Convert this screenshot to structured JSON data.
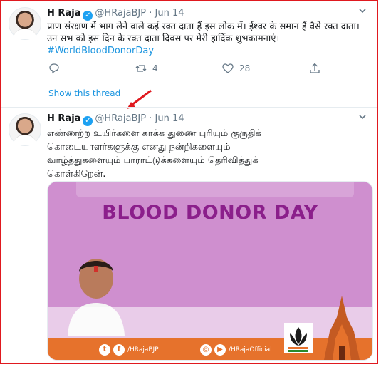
{
  "tweet1": {
    "name": "H Raja",
    "handle": "@HRajaBJP",
    "separator": "·",
    "date": "Jun 14",
    "text": "प्राण संरक्षण में भाग लेने वाले कई रक्त दाता हैं इस लोक में। ईश्वर के समान हैं वैसे रक्त दाता। उन सभ को इस दिन के रक्त दाता दिवस पर मेरी हार्दिक शुभकामनाएं।",
    "hashtag": "#WorldBloodDonorDay",
    "retweet_count": "4",
    "like_count": "28"
  },
  "show_thread": "Show this thread",
  "tweet2": {
    "name": "H Raja",
    "handle": "@HRajaBJP",
    "separator": "·",
    "date": "Jun 14",
    "text": "எண்ணற்ற உயிர்களை காக்க துணை புரியும் குருதிக் கொடையாளர்களுக்கு எனது நன்றிகளையும் வாழ்த்துகளையும் பாராட்டுக்களையும் தெரிவித்துக் கொள்கிறேன்."
  },
  "media": {
    "title": "BLOOD DONOR DAY",
    "social_left": "/HRajaBJP",
    "social_right": "/HRajaOfficial"
  },
  "colors": {
    "accent": "#1b95e0",
    "highlight_border": "#e0191f",
    "poster_bg": "#cf8fcf",
    "poster_title": "#8b1f8b",
    "poster_band": "#e6722c"
  },
  "icons": [
    "verified-icon",
    "chevron-down-icon",
    "reply-icon",
    "retweet-icon",
    "like-icon",
    "share-icon",
    "twitter-icon",
    "facebook-icon",
    "instagram-icon",
    "youtube-icon"
  ]
}
